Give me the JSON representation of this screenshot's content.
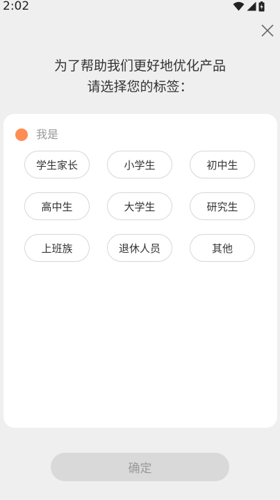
{
  "status_bar": {
    "time": "2:02",
    "icons": [
      "wifi-icon",
      "cellular-signal-icon",
      "battery-icon"
    ]
  },
  "close_icon": "close-icon",
  "headline": {
    "line1": "为了帮助我们更好地优化产品",
    "line2": "请选择您的标签："
  },
  "card": {
    "section_label": "我是",
    "accent_color": "#ff8c52",
    "tags": [
      "学生家长",
      "小学生",
      "初中生",
      "高中生",
      "大学生",
      "研究生",
      "上班族",
      "退休人员",
      "其他"
    ]
  },
  "confirm_button": {
    "label": "确定",
    "state": "disabled"
  }
}
